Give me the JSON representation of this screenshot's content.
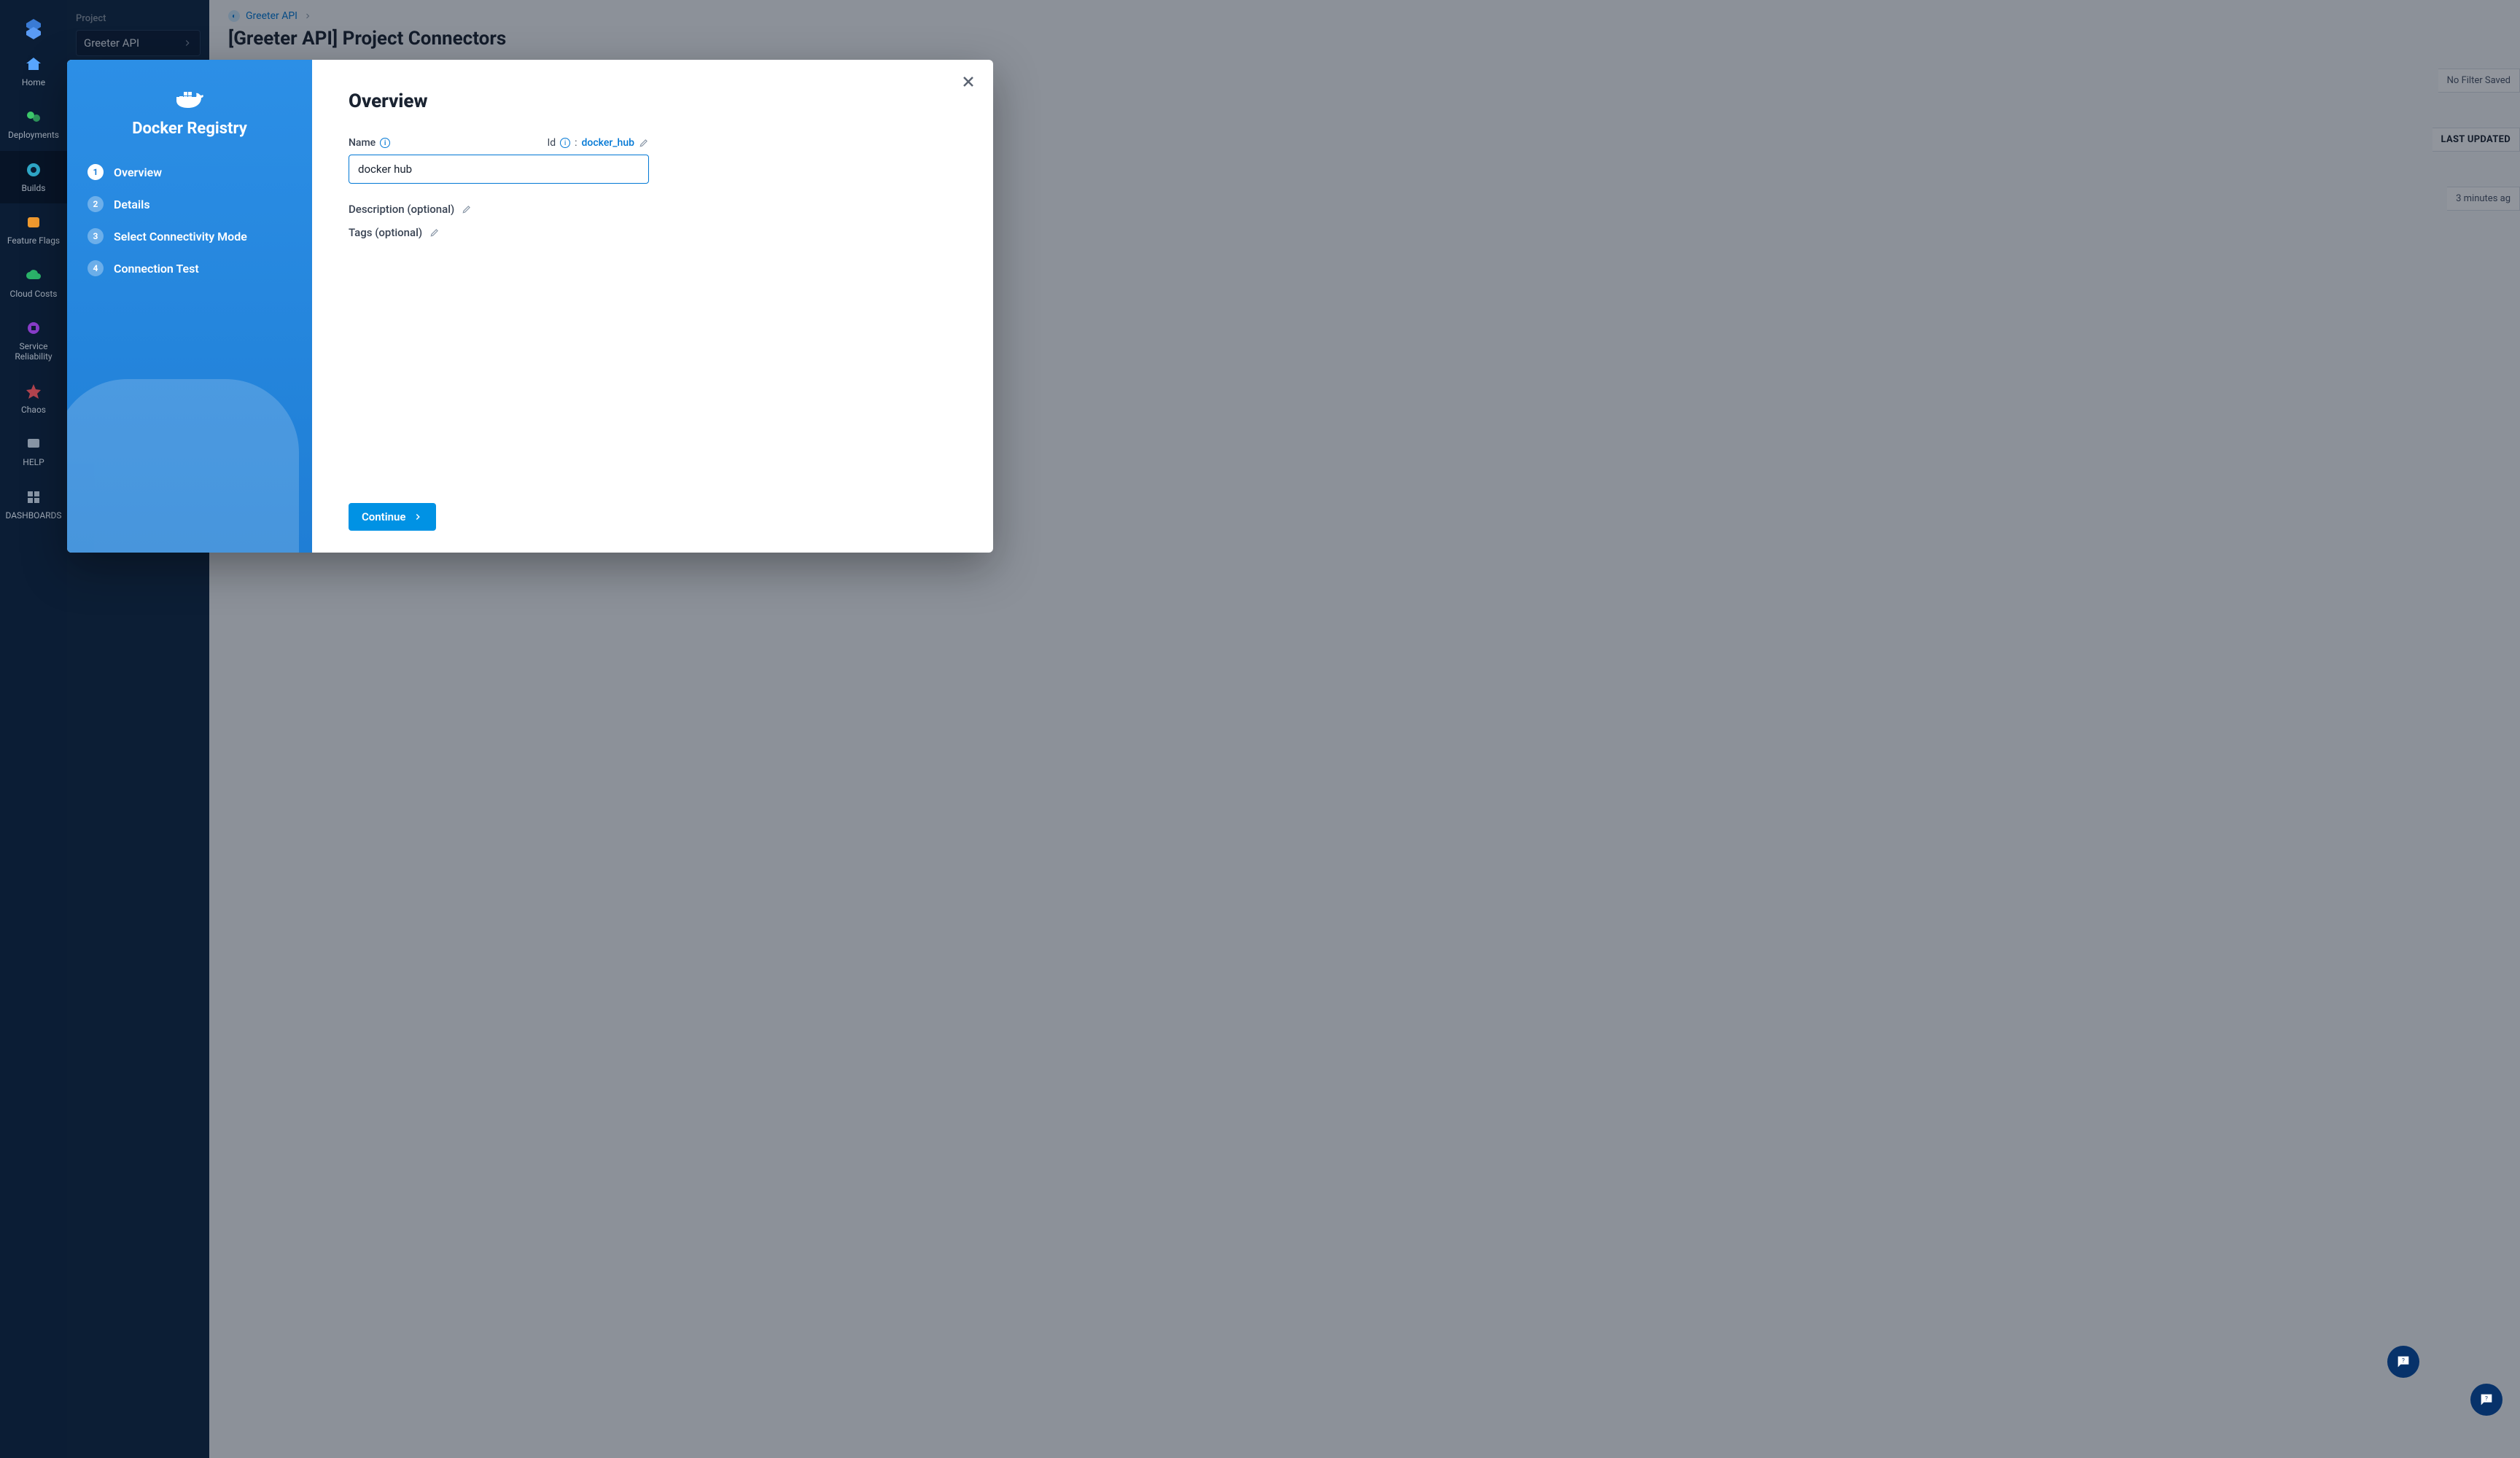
{
  "rail": {
    "home": "Home",
    "deployments": "Deployments",
    "builds": "Builds",
    "ff": "Feature Flags",
    "cc": "Cloud Costs",
    "srm": "Service Reliability",
    "chaos": "Chaos",
    "help": "HELP",
    "dash": "DASHBOARDS"
  },
  "side2": {
    "label": "Project",
    "project": "Greeter API"
  },
  "header": {
    "crumb": "Greeter API",
    "title": "[Greeter API] Project Connectors"
  },
  "right": {
    "filter": "No Filter Saved",
    "col": "LAST UPDATED",
    "val": "3 minutes ag"
  },
  "modal": {
    "title": "Docker Registry",
    "steps": {
      "s1": "Overview",
      "s2": "Details",
      "s3": "Select Connectivity Mode",
      "s4": "Connection Test"
    },
    "heading": "Overview",
    "name_label": "Name",
    "id_label": "Id",
    "id_value": "docker_hub",
    "name_value": "docker hub",
    "desc_label": "Description (optional)",
    "tags_label": "Tags (optional)",
    "continue": "Continue"
  }
}
